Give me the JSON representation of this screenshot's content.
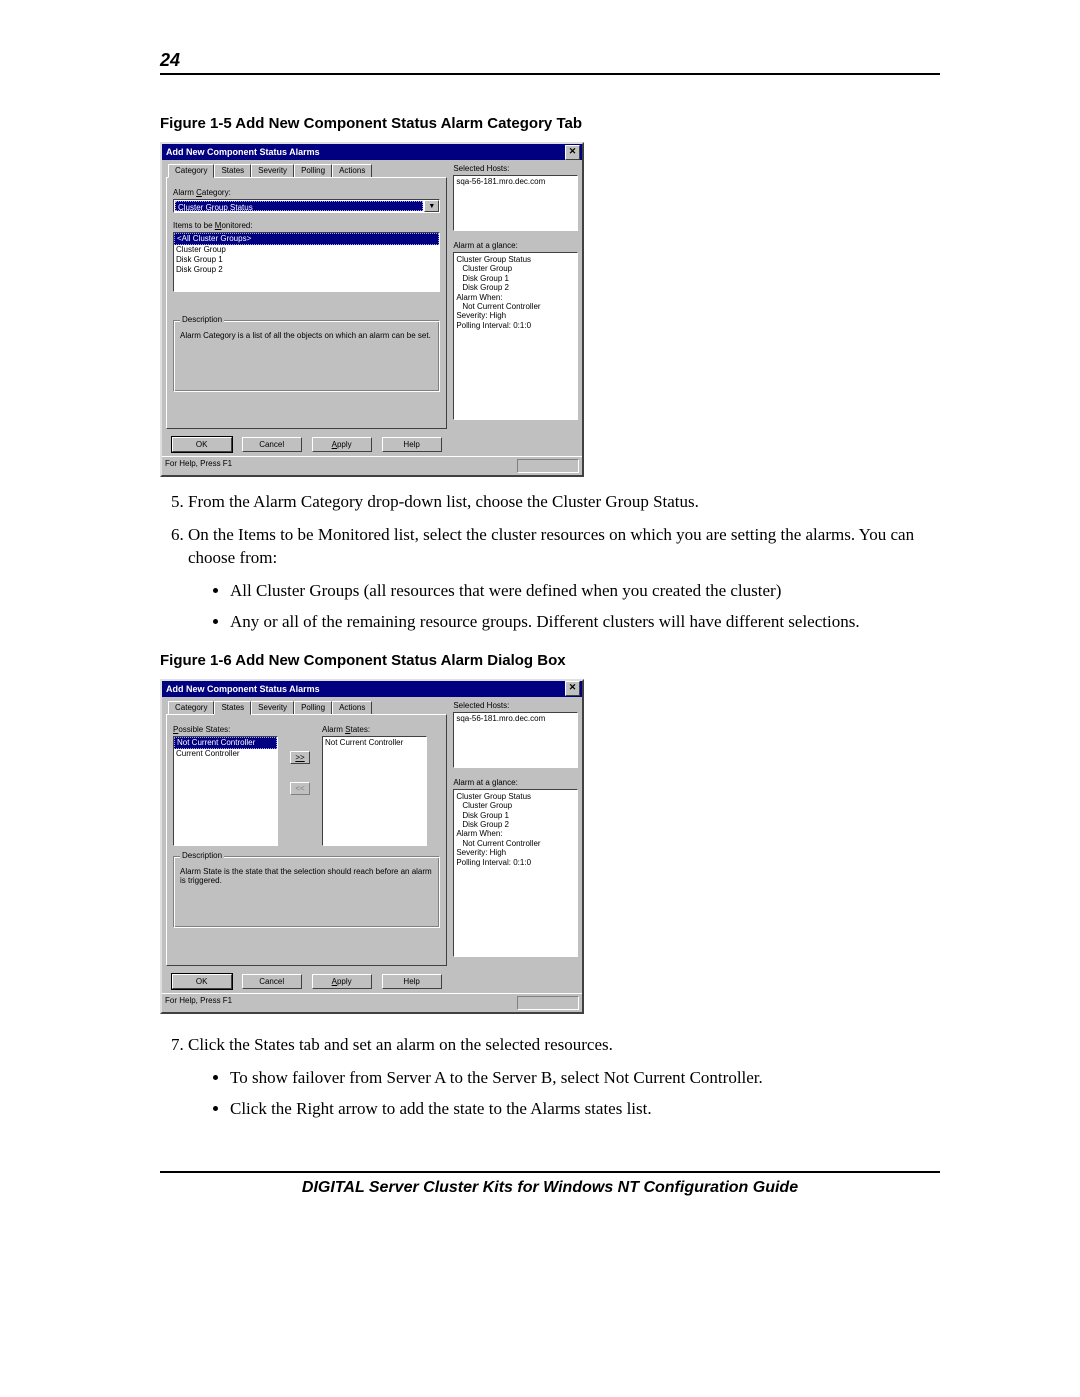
{
  "page": {
    "number": "24",
    "footer": "DIGITAL Server Cluster Kits for Windows NT Configuration Guide"
  },
  "figure1": {
    "caption": "Figure 1-5 Add New Component Status Alarm Category Tab",
    "title": "Add New Component Status Alarms",
    "tabs": {
      "t0": "Category",
      "t1": "States",
      "t2": "Severity",
      "t3": "Polling",
      "t4": "Actions"
    },
    "labels": {
      "alarm_category": "Alarm Category:",
      "items_monitored": "Items to be Monitored:",
      "description": "Description",
      "desc_text": "Alarm Category is a list of all the objects on which an alarm can be set.",
      "selected_hosts": "Selected Hosts:",
      "glance": "Alarm at a glance:"
    },
    "category_value": "Cluster Group Status",
    "items": {
      "sel": "<All Cluster Groups>",
      "i1": "Cluster Group",
      "i2": "Disk Group 1",
      "i3": "Disk Group 2"
    },
    "host": "sqa-56-181.mro.dec.com",
    "glance": {
      "g0": "Cluster Group Status",
      "g1": "Cluster Group",
      "g2": "Disk Group 1",
      "g3": "Disk Group 2",
      "g4": "Alarm When:",
      "g5": "Not Current Controller",
      "g6": "Severity: High",
      "g7": "Polling Interval: 0:1:0"
    },
    "buttons": {
      "ok": "OK",
      "cancel": "Cancel",
      "apply": "Apply",
      "help": "Help"
    },
    "status": "For Help, Press F1"
  },
  "steps1": {
    "s5": "From the Alarm Category drop-down list, choose the Cluster Group Status.",
    "s6": "On the Items to be Monitored list, select the cluster resources on which you are setting the alarms. You can choose from:",
    "b1": "All Cluster Groups (all resources that were defined when you created the cluster)",
    "b2": "Any or all of the remaining resource groups. Different clusters will have different selections."
  },
  "figure2": {
    "caption": "Figure 1-6 Add New Component Status Alarm Dialog Box",
    "title": "Add New Component Status Alarms",
    "tabs": {
      "t0": "Category",
      "t1": "States",
      "t2": "Severity",
      "t3": "Polling",
      "t4": "Actions"
    },
    "labels": {
      "possible_states": "Possible States:",
      "alarm_states": "Alarm States:",
      "description": "Description",
      "desc_text": "Alarm State is the state that the selection should reach before an alarm is triggered.",
      "selected_hosts": "Selected Hosts:",
      "glance": "Alarm at a glance:"
    },
    "possible": {
      "sel": "Not Current Controller",
      "p1": "Current Controller"
    },
    "alarm_state_value": "Not Current Controller",
    "movebtn_right": ">>",
    "movebtn_left": "<<",
    "host": "sqa-56-181.mro.dec.com",
    "glance": {
      "g0": "Cluster Group Status",
      "g1": "Cluster Group",
      "g2": "Disk Group 1",
      "g3": "Disk Group 2",
      "g4": "Alarm When:",
      "g5": "Not Current Controller",
      "g6": "Severity: High",
      "g7": "Polling Interval: 0:1:0"
    },
    "buttons": {
      "ok": "OK",
      "cancel": "Cancel",
      "apply": "Apply",
      "help": "Help"
    },
    "status": "For Help, Press F1"
  },
  "steps2": {
    "s7": "Click the States tab and set an alarm on the selected resources.",
    "b1": "To show failover from Server A to the Server B, select Not Current Controller.",
    "b2": "Click the Right arrow to add the state to the Alarms states list."
  }
}
